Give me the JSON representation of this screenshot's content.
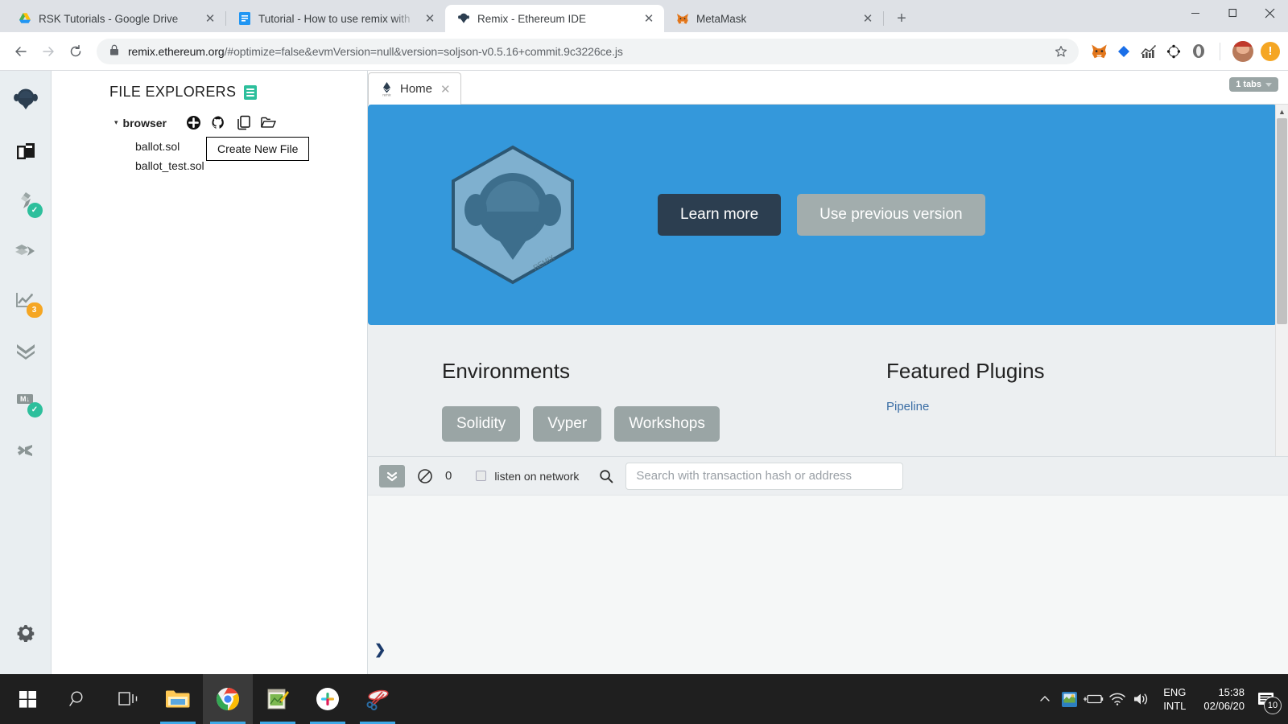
{
  "browser": {
    "tabs": [
      {
        "title": "RSK Tutorials - Google Drive",
        "favicon": "google-drive-icon",
        "active": false
      },
      {
        "title": "Tutorial - How to use remix with",
        "favicon": "google-docs-icon",
        "active": false
      },
      {
        "title": "Remix - Ethereum IDE",
        "favicon": "remix-icon",
        "active": true
      },
      {
        "title": "MetaMask",
        "favicon": "metamask-fox-icon",
        "active": false
      }
    ],
    "new_tab_label": "+",
    "window_controls": {
      "minimize": "─",
      "maximize": "❑",
      "close": "✕"
    },
    "nav": {
      "back": "←",
      "forward": "→",
      "reload": "⟳"
    },
    "omnibox": {
      "lock_icon": "lock-icon",
      "host": "remix.ethereum.org",
      "path": "/#optimize=false&evmVersion=null&version=soljson-v0.5.16+commit.9c3226ce.js",
      "full_url": "remix.ethereum.org/#optimize=false&evmVersion=null&version=soljson-v0.5.16+commit.9c3226ce.js",
      "star_icon": "star-outline-icon"
    },
    "extensions": [
      {
        "name": "metamask-extension-icon"
      },
      {
        "name": "diamond-extension-icon"
      },
      {
        "name": "analytics-extension-icon"
      },
      {
        "name": "ethereum-extension-icon"
      },
      {
        "name": "opera-extension-icon"
      }
    ],
    "profile": {
      "name": "user-avatar"
    },
    "alert": {
      "name": "update-alert-icon",
      "glyph": "!"
    }
  },
  "ide": {
    "rail": [
      {
        "name": "remix-home-icon",
        "badge": null
      },
      {
        "name": "file-explorers-icon",
        "badge": null
      },
      {
        "name": "solidity-compiler-icon",
        "badge": "check"
      },
      {
        "name": "deploy-run-icon",
        "badge": null
      },
      {
        "name": "analysis-icon",
        "badge": "3"
      },
      {
        "name": "debugger-icon",
        "badge": null
      },
      {
        "name": "markdown-docs-icon",
        "badge": "check"
      },
      {
        "name": "plugin-manager-icon",
        "badge": null
      }
    ],
    "settings_icon": "gear-icon",
    "panel": {
      "title": "FILE EXPLORERS",
      "title_icon": "docs-icon",
      "tree_root": "browser",
      "caret": "▾",
      "actions": [
        {
          "name": "create-new-file-icon"
        },
        {
          "name": "connect-github-icon"
        },
        {
          "name": "copy-files-icon"
        },
        {
          "name": "open-folder-icon"
        }
      ],
      "files": [
        "ballot.sol",
        "ballot_test.sol"
      ],
      "tooltip": "Create New File"
    },
    "editor_tabs": {
      "items": [
        {
          "label": "Home",
          "icon": "remix-tab-icon",
          "close": "✕"
        }
      ],
      "badge": "1 tabs"
    },
    "home": {
      "hero": {
        "logo": "remix-hexagon-logo",
        "logo_text": "REMIX",
        "learn_more": "Learn more",
        "use_previous": "Use previous version",
        "bg_color": "#3498db"
      },
      "environments": {
        "title": "Environments",
        "buttons": [
          "Solidity",
          "Vyper",
          "Workshops"
        ]
      },
      "plugins": {
        "title": "Featured Plugins",
        "items": [
          "Pipeline"
        ]
      }
    },
    "terminal": {
      "toggle_icon": "chevron-double-down-icon",
      "clear_icon": "ban-circle-icon",
      "count": "0",
      "listen_label": "listen on network",
      "search_icon": "search-icon",
      "search_placeholder": "Search with transaction hash or address",
      "prompt": "❯"
    }
  },
  "taskbar": {
    "items": [
      {
        "name": "start-button-icon",
        "running": false,
        "active": false
      },
      {
        "name": "search-taskbar-icon",
        "running": false,
        "active": false
      },
      {
        "name": "task-view-icon",
        "running": false,
        "active": false
      },
      {
        "name": "file-explorer-taskbar-icon",
        "running": true,
        "active": false
      },
      {
        "name": "chrome-taskbar-icon",
        "running": true,
        "active": true
      },
      {
        "name": "notepad-taskbar-icon",
        "running": true,
        "active": false
      },
      {
        "name": "slack-taskbar-icon",
        "running": true,
        "active": false
      },
      {
        "name": "snipping-tool-taskbar-icon",
        "running": true,
        "active": false
      }
    ],
    "tray": {
      "chevron": "⌃",
      "icons": [
        "intel-graphics-icon",
        "battery-charging-icon",
        "wifi-icon",
        "volume-icon"
      ],
      "language_line1": "ENG",
      "language_line2": "INTL",
      "time": "15:38",
      "date": "02/06/20",
      "notification_icon": "action-center-icon",
      "notification_count": "10"
    }
  }
}
